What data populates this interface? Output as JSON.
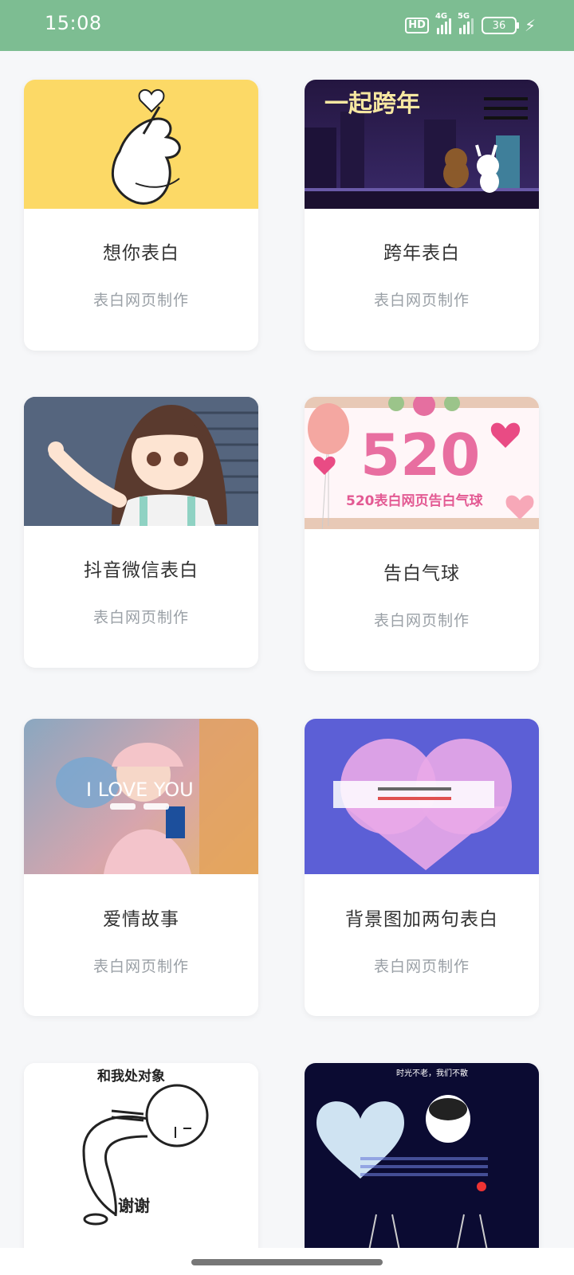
{
  "status_bar": {
    "time": "15:08",
    "hd_label": "HD",
    "net1_label": "4G",
    "net2_label": "5G",
    "battery": "36"
  },
  "cards": [
    {
      "title": "想你表白",
      "subtitle": "表白网页制作",
      "thumb_text": ""
    },
    {
      "title": "跨年表白",
      "subtitle": "表白网页制作",
      "thumb_text": "一起跨年"
    },
    {
      "title": "抖音微信表白",
      "subtitle": "表白网页制作",
      "thumb_text": ""
    },
    {
      "title": "告白气球",
      "subtitle": "表白网页制作",
      "thumb_text": "520",
      "thumb_caption": "520表白网页告白气球"
    },
    {
      "title": "爱情故事",
      "subtitle": "表白网页制作",
      "thumb_text": "I LOVE YOU"
    },
    {
      "title": "背景图加两句表白",
      "subtitle": "表白网页制作",
      "thumb_text": ""
    },
    {
      "title": "",
      "subtitle": "",
      "thumb_text": "和我处对象",
      "thumb_caption": "谢谢"
    },
    {
      "title": "",
      "subtitle": "",
      "thumb_text": "时光不老，我们不散"
    }
  ],
  "colors": {
    "status_bar": "#7dbd92",
    "background": "#f6f7f9",
    "title_text": "#333333",
    "subtitle_text": "#9aa0a6"
  }
}
